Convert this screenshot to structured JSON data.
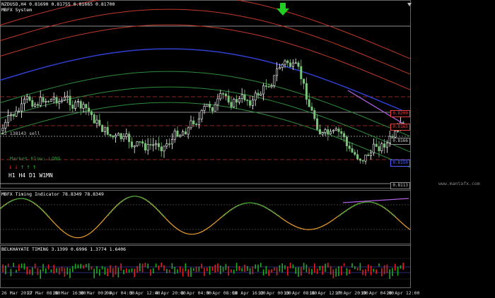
{
  "main_panel": {
    "symbol_line": "NZDUSD,H4  0.81690 0.81755 0.81665 0.81700",
    "system_name": "MBFX System",
    "sell_line_label": "#2 138143 sell",
    "trend_label": "Market Flow: LONG",
    "timeframes": [
      "H1",
      "H4",
      "D1",
      "W1MN"
    ],
    "timeframe_arrows": [
      "down",
      "down",
      "up",
      "up",
      "up"
    ],
    "price_tags": [
      "0.8200",
      "0.8165",
      "0.8166",
      "0.8150",
      "0.8113"
    ],
    "watermark": "www.mantafx.com"
  },
  "timing_panel": {
    "label": "MBFX Timing Indicator 78.8349 78.8349"
  },
  "belkhayate_panel": {
    "label": "BELKHAYATE TIMING  3.1399 0.6996 1.3774 1.6406"
  },
  "time_axis": {
    "labels": [
      "26 Mar 2012",
      "27 Mar 08:00",
      "28 Mar 16:00",
      "30 Mar 00:00",
      "2 Apr 04:00",
      "3 Apr 12:00",
      "4 Apr 20:00",
      "6 Apr 04:00",
      "9 Apr 08:00",
      "10 Apr 16:00",
      "12 Apr 00:00",
      "13 Apr 08:00",
      "16 Apr 12:00",
      "17 Apr 20:00",
      "19 Apr 04:00",
      "20 Apr 12:00"
    ]
  },
  "colors": {
    "background": "#000000",
    "bull_candle": "#ffffff",
    "bear_candle": "#7cc47c",
    "upper_band": "#c0392b",
    "mid_line": "#2f3fd0",
    "lower_band": "#2e8b3a",
    "timing_green": "#2e9b2e",
    "timing_orange": "#f0a030",
    "divergence": "#b060e0",
    "arrow_green": "#22cc22",
    "hist_red": "#e02020",
    "hist_green": "#22aa22"
  }
}
